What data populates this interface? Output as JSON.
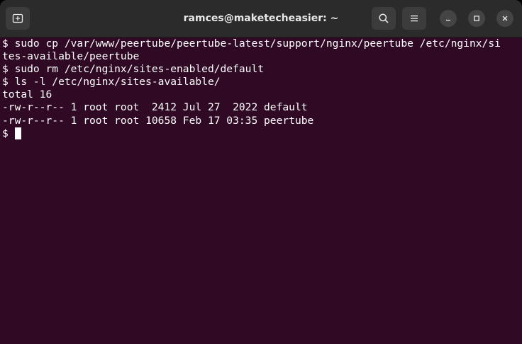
{
  "window": {
    "title": "ramces@maketecheasier: ~"
  },
  "toolbar": {
    "new_tab_icon": "new-tab-icon",
    "search_icon": "search-icon",
    "menu_icon": "hamburger-menu-icon",
    "minimize_icon": "minimize-icon",
    "maximize_icon": "maximize-icon",
    "close_icon": "close-icon"
  },
  "terminal": {
    "lines": [
      "$ sudo cp /var/www/peertube/peertube-latest/support/nginx/peertube /etc/nginx/si",
      "tes-available/peertube",
      "$ sudo rm /etc/nginx/sites-enabled/default",
      "$ ls -l /etc/nginx/sites-available/",
      "total 16",
      "-rw-r--r-- 1 root root  2412 Jul 27  2022 default",
      "-rw-r--r-- 1 root root 10658 Feb 17 03:35 peertube"
    ],
    "prompt": "$ "
  },
  "colors": {
    "background": "#300a24",
    "titlebar": "#2b2b2b",
    "text": "#ffffff"
  }
}
